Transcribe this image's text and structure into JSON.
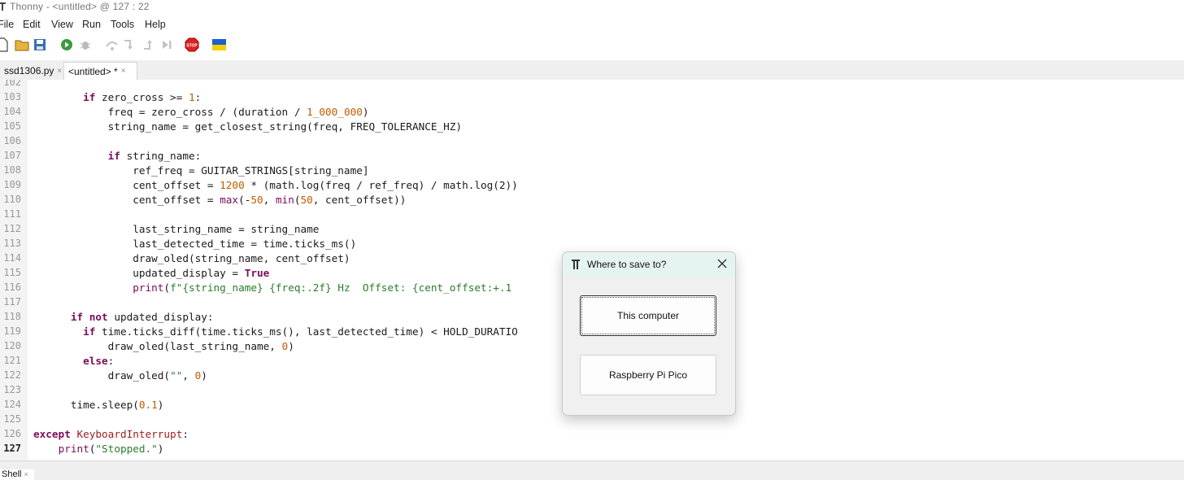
{
  "window": {
    "title": "Thonny  -  <untitled>  @  127 : 22"
  },
  "menu": [
    "File",
    "Edit",
    "View",
    "Run",
    "Tools",
    "Help"
  ],
  "toolbar": {
    "icons": [
      "new-file-icon",
      "open-folder-icon",
      "save-icon",
      "run-icon",
      "debug-icon",
      "step-over-icon",
      "step-into-icon",
      "step-out-icon",
      "resume-icon",
      "stop-icon",
      "ukraine-flag-icon"
    ]
  },
  "tabs": [
    {
      "label": "ssd1306.py",
      "close": "×"
    },
    {
      "label": "<untitled> *",
      "close": "×"
    }
  ],
  "editor": {
    "current_line": "127",
    "lines": [
      {
        "n": "102"
      },
      {
        "n": "103"
      },
      {
        "n": "104"
      },
      {
        "n": "105"
      },
      {
        "n": "106"
      },
      {
        "n": "107"
      },
      {
        "n": "108"
      },
      {
        "n": "109"
      },
      {
        "n": "110"
      },
      {
        "n": "111"
      },
      {
        "n": "112"
      },
      {
        "n": "113"
      },
      {
        "n": "114"
      },
      {
        "n": "115"
      },
      {
        "n": "116"
      },
      {
        "n": "117"
      },
      {
        "n": "118"
      },
      {
        "n": "119"
      },
      {
        "n": "120"
      },
      {
        "n": "121"
      },
      {
        "n": "122"
      },
      {
        "n": "123"
      },
      {
        "n": "124"
      },
      {
        "n": "125"
      },
      {
        "n": "126"
      },
      {
        "n": "127"
      }
    ],
    "code": [
      [],
      [
        [
          "",
          "        "
        ],
        [
          "kw",
          "if"
        ],
        [
          "",
          " zero_cross >= "
        ],
        [
          "num",
          "1"
        ],
        [
          "",
          ":"
        ]
      ],
      [
        [
          "",
          "            freq = zero_cross / (duration / "
        ],
        [
          "num",
          "1_000_000"
        ],
        [
          "",
          ")"
        ]
      ],
      [
        [
          "",
          "            string_name = get_closest_string(freq, FREQ_TOLERANCE_HZ)"
        ]
      ],
      [],
      [
        [
          "",
          "            "
        ],
        [
          "kw",
          "if"
        ],
        [
          "",
          " string_name:"
        ]
      ],
      [
        [
          "",
          "                ref_freq = GUITAR_STRINGS[string_name]"
        ]
      ],
      [
        [
          "",
          "                cent_offset = "
        ],
        [
          "num",
          "1200"
        ],
        [
          "",
          " * (math.log(freq / ref_freq) / math.log(2))"
        ]
      ],
      [
        [
          "",
          "                cent_offset = "
        ],
        [
          "bi",
          "max"
        ],
        [
          "",
          "(-"
        ],
        [
          "num",
          "50"
        ],
        [
          "",
          ", "
        ],
        [
          "bi",
          "min"
        ],
        [
          "",
          "("
        ],
        [
          "num",
          "50"
        ],
        [
          "",
          ", cent_offset))"
        ]
      ],
      [],
      [
        [
          "",
          "                last_string_name = string_name"
        ]
      ],
      [
        [
          "",
          "                last_detected_time = time.ticks_ms()"
        ]
      ],
      [
        [
          "",
          "                draw_oled(string_name, cent_offset)"
        ]
      ],
      [
        [
          "",
          "                updated_display = "
        ],
        [
          "kw",
          "True"
        ]
      ],
      [
        [
          "",
          "                "
        ],
        [
          "bi",
          "print"
        ],
        [
          "",
          "("
        ],
        [
          "str",
          "f\"{string_name} {freq:.2f} Hz  Offset: {cent_offset:+.1"
        ]
      ],
      [],
      [
        [
          "",
          "      "
        ],
        [
          "kw",
          "if not"
        ],
        [
          "",
          " updated_display:"
        ]
      ],
      [
        [
          "",
          "        "
        ],
        [
          "kw",
          "if"
        ],
        [
          "",
          " time.ticks_diff(time.ticks_ms(), last_detected_time) < HOLD_DURATIO"
        ]
      ],
      [
        [
          "",
          "            draw_oled(last_string_name, "
        ],
        [
          "num",
          "0"
        ],
        [
          "",
          ")"
        ]
      ],
      [
        [
          "",
          "        "
        ],
        [
          "kw",
          "else"
        ],
        [
          "",
          ":"
        ]
      ],
      [
        [
          "",
          "            draw_oled("
        ],
        [
          "str",
          "\"\""
        ],
        [
          "",
          ", "
        ],
        [
          "num",
          "0"
        ],
        [
          "",
          ")"
        ]
      ],
      [],
      [
        [
          "",
          "      time.sleep("
        ],
        [
          "num",
          "0.1"
        ],
        [
          "",
          ")"
        ]
      ],
      [],
      [
        [
          "kw",
          "except"
        ],
        [
          "",
          " "
        ],
        [
          "exc",
          "KeyboardInterrupt"
        ],
        [
          "",
          ":"
        ]
      ],
      [
        [
          "",
          "    "
        ],
        [
          "bi",
          "print"
        ],
        [
          "",
          "("
        ],
        [
          "str",
          "\"Stopped.\""
        ],
        [
          "",
          ")"
        ]
      ]
    ]
  },
  "bottom_panel": {
    "tab_label": "Shell",
    "close": "×"
  },
  "dialog": {
    "title": "Where to save to?",
    "option_this_computer": "This computer",
    "option_pico": "Raspberry Pi Pico"
  },
  "colors": {
    "keyword": "#7a0d5a",
    "number": "#c15b00",
    "string": "#2a7d2a",
    "dialog_title_bg": "#e6f4f1",
    "tab_bar": "#efefef"
  }
}
